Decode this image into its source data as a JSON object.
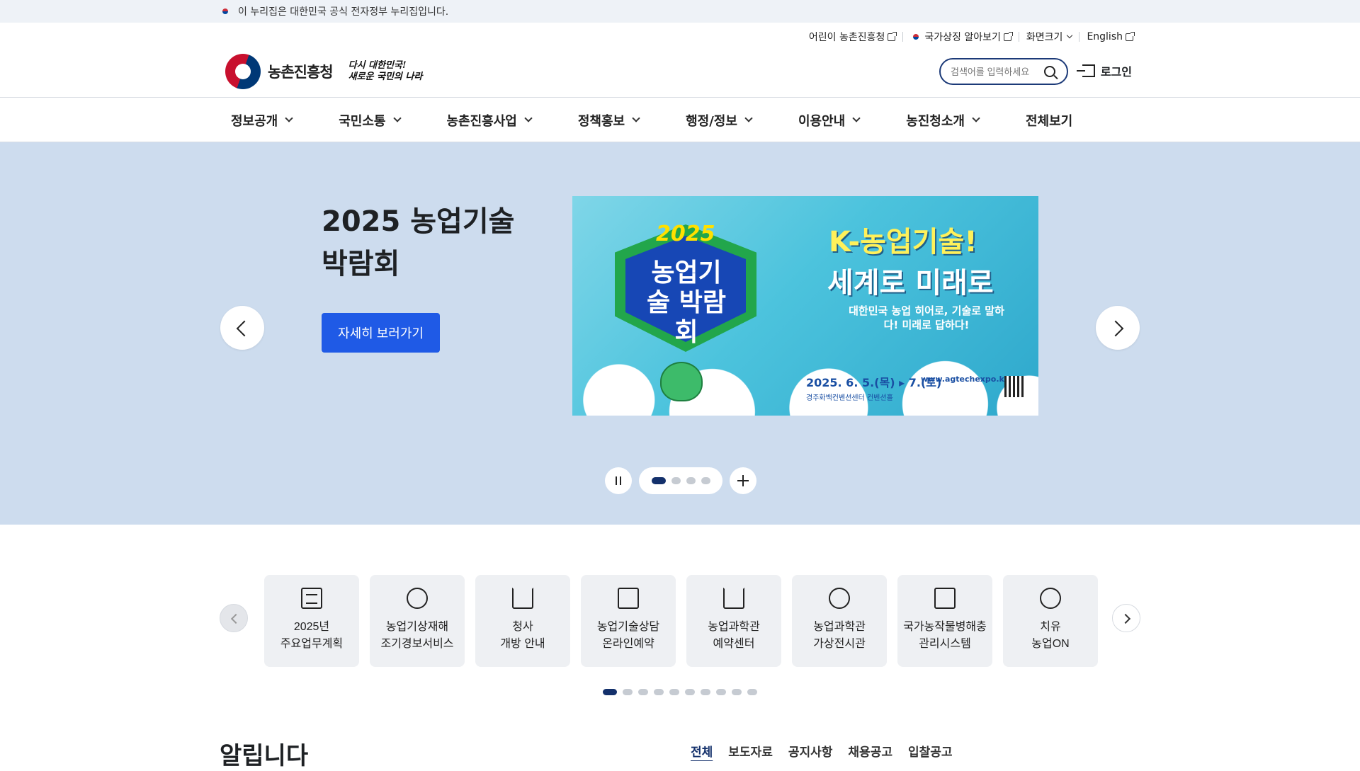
{
  "gov_banner": {
    "text": "이 누리집은 대한민국 공식 전자정부 누리집입니다."
  },
  "utility": [
    {
      "label": "어린이 농촌진흥청",
      "icon": "external-link-icon"
    },
    {
      "label": "국가상징 알아보기",
      "icon": "external-link-icon"
    },
    {
      "label": "화면크기",
      "icon": "chevron-down-icon"
    },
    {
      "label": "English",
      "icon": "external-link-icon"
    }
  ],
  "logo": {
    "name": "농촌진흥청",
    "slogan_line1": "다시 대한민국!",
    "slogan_line2": "새로운 국민의 나라"
  },
  "search": {
    "placeholder": "검색어를 입력하세요"
  },
  "login": {
    "label": "로그인"
  },
  "nav": [
    {
      "label": "정보공개",
      "dropdown": true
    },
    {
      "label": "국민소통",
      "dropdown": true
    },
    {
      "label": "농촌진흥사업",
      "dropdown": true
    },
    {
      "label": "정책홍보",
      "dropdown": true
    },
    {
      "label": "행정/정보",
      "dropdown": true
    },
    {
      "label": "이용안내",
      "dropdown": true
    },
    {
      "label": "농진청소개",
      "dropdown": true
    },
    {
      "label": "전체보기",
      "dropdown": false
    }
  ],
  "hero": {
    "title_line1": "2025 농업기술",
    "title_line2": "박람회",
    "button": "자세히 보러가기",
    "slide_count": 4,
    "active_slide": 1,
    "banner": {
      "year": "2025",
      "name": "농업기술 박람회",
      "headline1": "K-농업기술!",
      "headline2": "세계로 미래로",
      "sub": "대한민국 농업 히어로, 기술로 말하다! 미래로 답하다!",
      "date": "2025. 6. 5.(목) ▸ 7.(토)",
      "url": "www.agtechexpo.kr",
      "venue": "경주화백컨벤션센터 컨벤션홀"
    }
  },
  "quick_menu": [
    {
      "label": "2025년\n주요업무계획",
      "icon": "clipboard-icon"
    },
    {
      "label": "농업기상재해\n조기경보서비스",
      "icon": "weather-icon"
    },
    {
      "label": "청사\n개방 안내",
      "icon": "building-icon"
    },
    {
      "label": "농업기술상담\n온라인예약",
      "icon": "pen-icon"
    },
    {
      "label": "농업과학관\n예약센터",
      "icon": "museum-icon"
    },
    {
      "label": "농업과학관\n가상전시관",
      "icon": "globe-icon"
    },
    {
      "label": "국가농작물병해충\n관리시스템",
      "icon": "bug-scan-icon"
    },
    {
      "label": "치유\n농업ON",
      "icon": "tree-icon"
    }
  ],
  "quick_pages": 10,
  "notice": {
    "title": "알립니다",
    "tabs": [
      "전체",
      "보도자료",
      "공지사항",
      "채용공고",
      "입찰공고"
    ],
    "active_tab": 0
  },
  "colors": {
    "primary": "#1f5ae6",
    "navy": "#13306b",
    "hero_bg": "#cddcee"
  }
}
